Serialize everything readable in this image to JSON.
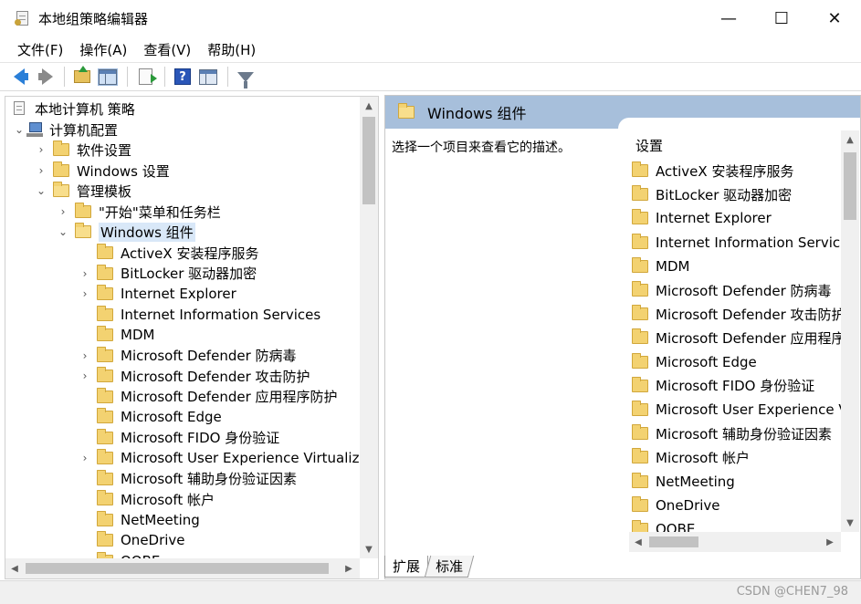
{
  "window": {
    "title": "本地组策略编辑器",
    "minimize_glyph": "—",
    "maximize_glyph": "☐",
    "close_glyph": "✕"
  },
  "menu": [
    "文件(F)",
    "操作(A)",
    "查看(V)",
    "帮助(H)"
  ],
  "toolbar": {
    "buttons": [
      "back-icon",
      "forward-icon",
      "up-folder-icon",
      "show-hide-tree-icon",
      "export-list-icon",
      "help-icon",
      "show-hide-action-pane-icon",
      "filter-icon"
    ],
    "help_glyph": "?"
  },
  "tree": {
    "root": "本地计算机 策略",
    "computer_config": "计算机配置",
    "software_settings": "软件设置",
    "windows_settings": "Windows 设置",
    "admin_templates": "管理模板",
    "start_menu": "\"开始\"菜单和任务栏",
    "windows_components": "Windows 组件",
    "children": [
      {
        "label": "ActiveX 安装程序服务",
        "expandable": false
      },
      {
        "label": "BitLocker 驱动器加密",
        "expandable": true
      },
      {
        "label": "Internet Explorer",
        "expandable": true
      },
      {
        "label": "Internet Information Services",
        "expandable": false
      },
      {
        "label": "MDM",
        "expandable": false
      },
      {
        "label": "Microsoft Defender 防病毒",
        "expandable": true
      },
      {
        "label": "Microsoft Defender 攻击防护",
        "expandable": true
      },
      {
        "label": "Microsoft Defender 应用程序防护",
        "expandable": false
      },
      {
        "label": "Microsoft Edge",
        "expandable": false
      },
      {
        "label": "Microsoft FIDO 身份验证",
        "expandable": false
      },
      {
        "label": "Microsoft User Experience Virtualizatic",
        "expandable": true
      },
      {
        "label": "Microsoft 辅助身份验证因素",
        "expandable": false
      },
      {
        "label": "Microsoft 帐户",
        "expandable": false
      },
      {
        "label": "NetMeeting",
        "expandable": false
      },
      {
        "label": "OneDrive",
        "expandable": false
      },
      {
        "label": "OOBE",
        "expandable": false
      }
    ]
  },
  "right_pane": {
    "header": "Windows 组件",
    "description": "选择一个项目来查看它的描述。",
    "list_header": "设置",
    "items": [
      "ActiveX 安装程序服务",
      "BitLocker 驱动器加密",
      "Internet Explorer",
      "Internet Information Services",
      "MDM",
      "Microsoft Defender 防病毒",
      "Microsoft Defender 攻击防护",
      "Microsoft Defender 应用程序防",
      "Microsoft Edge",
      "Microsoft FIDO 身份验证",
      "Microsoft User Experience Virt",
      "Microsoft 辅助身份验证因素",
      "Microsoft 帐户",
      "NetMeeting",
      "OneDrive",
      "OOBE"
    ]
  },
  "tabs": {
    "extended": "扩展",
    "standard": "标准"
  },
  "status": {
    "watermark": "CSDN @CHEN7_98"
  }
}
